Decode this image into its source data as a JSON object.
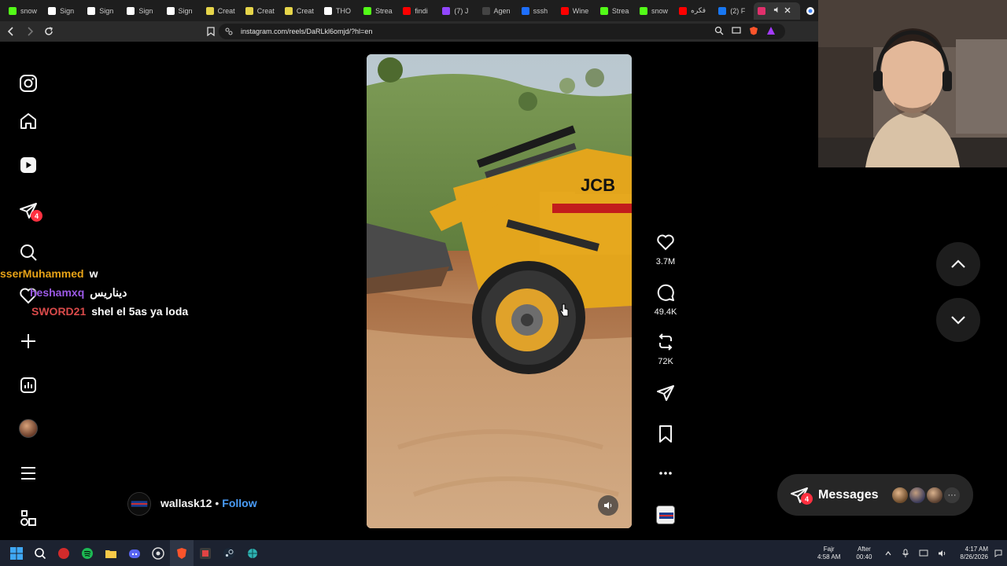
{
  "browser": {
    "tabs": [
      {
        "label": "snow",
        "fav_color": "#53fc18"
      },
      {
        "label": "Sign",
        "fav_color": "#ffffff"
      },
      {
        "label": "Sign",
        "fav_color": "#ffffff"
      },
      {
        "label": "Sign",
        "fav_color": "#ffffff"
      },
      {
        "label": "Sign",
        "fav_color": "#ffffff"
      },
      {
        "label": "Creat",
        "fav_color": "#e6d54a"
      },
      {
        "label": "Creat",
        "fav_color": "#e6d54a"
      },
      {
        "label": "Creat",
        "fav_color": "#e6d54a"
      },
      {
        "label": "THO",
        "fav_color": "#ffffff"
      },
      {
        "label": "Strea",
        "fav_color": "#53fc18"
      },
      {
        "label": "findi",
        "fav_color": "#ff0000"
      },
      {
        "label": "(7) J",
        "fav_color": "#9146ff"
      },
      {
        "label": "Agen",
        "fav_color": "#444444"
      },
      {
        "label": "sssh",
        "fav_color": "#1e6fff"
      },
      {
        "label": "Wine",
        "fav_color": "#ff0000"
      },
      {
        "label": "Strea",
        "fav_color": "#53fc18"
      },
      {
        "label": "snow",
        "fav_color": "#53fc18"
      },
      {
        "label": "فكره",
        "fav_color": "#ff0000"
      },
      {
        "label": "(2) F",
        "fav_color": "#1877f2"
      },
      {
        "label": "",
        "fav_color": "#e1306c"
      }
    ],
    "url": "instagram.com/reels/DaRLkl6omjd/?hl=en"
  },
  "sidebar": {
    "notifications_count": "4"
  },
  "chat": [
    {
      "user": "sserMuhammed",
      "message": "w",
      "color": "#e8a317"
    },
    {
      "user": "heshamxq",
      "message": "دیناریس",
      "color": "#9b59e6"
    },
    {
      "user": "SWORD21",
      "message": "shel el 5as ya loda",
      "color": "#d94a4a"
    }
  ],
  "reel": {
    "likes": "3.7M",
    "comments": "49.4K",
    "reposts": "72K",
    "author": "wallask12",
    "separator": "•",
    "follow_label": "Follow",
    "video_brand": "JCB"
  },
  "messages": {
    "label": "Messages",
    "badge": "4"
  },
  "taskbar": {
    "prayer_name": "Fajr",
    "prayer_time": "4:58 AM",
    "after_label": "After",
    "after_time": "00:40",
    "clock_time": "4:17 AM",
    "clock_date": "8/26/2026"
  }
}
